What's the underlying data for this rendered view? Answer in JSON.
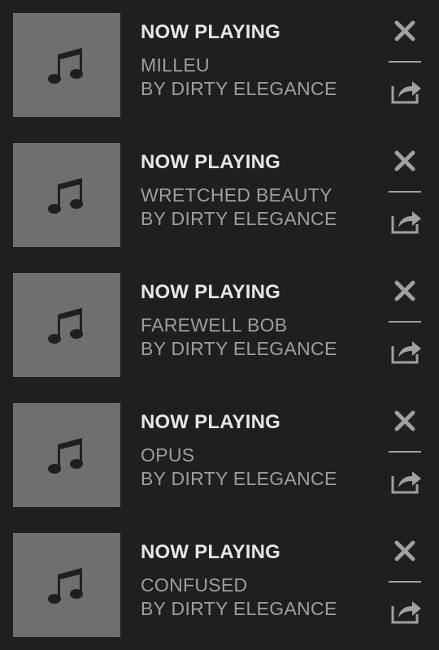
{
  "colors": {
    "background": "#1f1f1f",
    "artwork": "#6f6f6f",
    "note_icon": "#1f1f1f",
    "label": "#e6e6e6",
    "secondary_text": "#9e9e9e",
    "icon": "#a0a0a0"
  },
  "icons": {
    "artwork": "music-note-icon",
    "close": "close-icon",
    "share": "share-icon"
  },
  "items": [
    {
      "label": "NOW PLAYING",
      "title": "MILLEU",
      "artist": "BY DIRTY ELEGANCE"
    },
    {
      "label": "NOW PLAYING",
      "title": "WRETCHED BEAUTY",
      "artist": "BY DIRTY ELEGANCE"
    },
    {
      "label": "NOW PLAYING",
      "title": "FAREWELL BOB",
      "artist": "BY DIRTY ELEGANCE"
    },
    {
      "label": "NOW PLAYING",
      "title": "OPUS",
      "artist": "BY DIRTY ELEGANCE"
    },
    {
      "label": "NOW PLAYING",
      "title": "CONFUSED",
      "artist": "BY DIRTY ELEGANCE"
    }
  ]
}
